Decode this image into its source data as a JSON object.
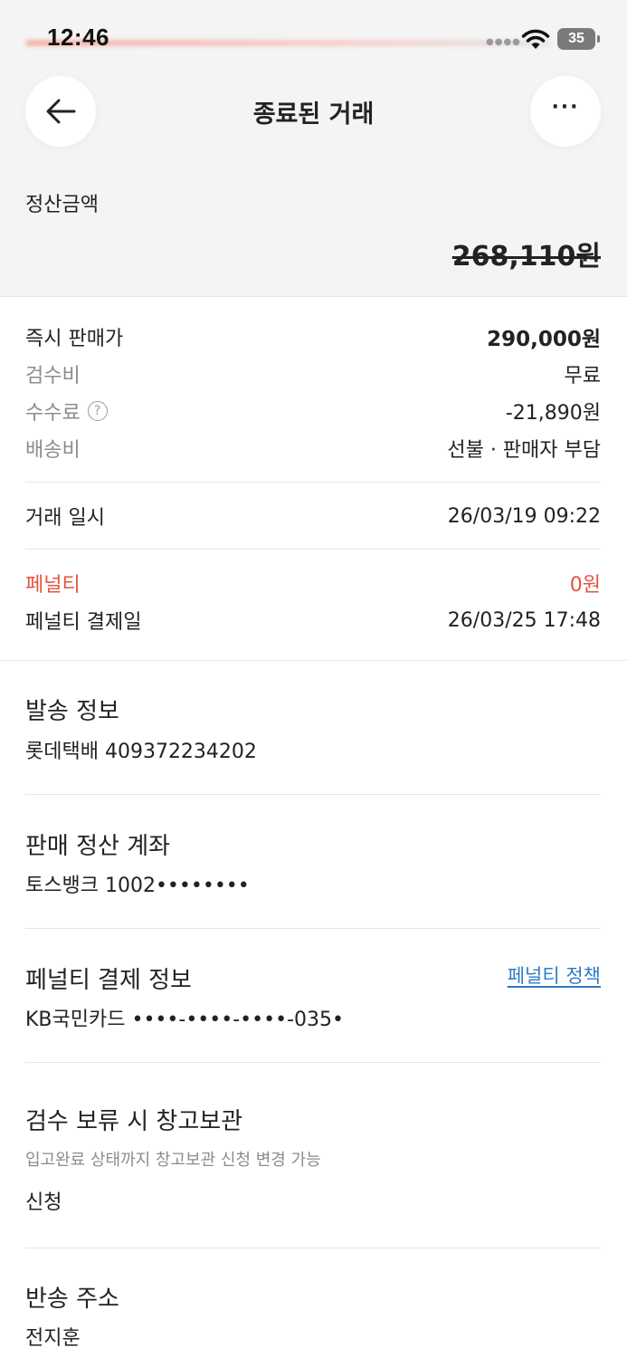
{
  "status_bar": {
    "time": "12:46",
    "battery": "35"
  },
  "header": {
    "title": "종료된 거래"
  },
  "settlement": {
    "label": "정산금액",
    "amount": "268,110원"
  },
  "price_details": {
    "instant_price_label": "즉시 판매가",
    "instant_price_value": "290,000원",
    "inspection_fee_label": "검수비",
    "inspection_fee_value": "무료",
    "commission_label": "수수료",
    "commission_value": "-21,890원",
    "shipping_label": "배송비",
    "shipping_value": "선불 · 판매자 부담"
  },
  "trade": {
    "date_label": "거래 일시",
    "date_value": "26/03/19 09:22"
  },
  "penalty": {
    "label": "페널티",
    "value": "0원",
    "pay_date_label": "페널티 결제일",
    "pay_date_value": "26/03/25 17:48"
  },
  "sections": {
    "shipping_info_title": "발송 정보",
    "shipping_info_value": "롯데택배 409372234202",
    "settlement_account_title": "판매 정산 계좌",
    "settlement_account_value": "토스뱅크 1002••••••••",
    "penalty_payment_title": "페널티 결제 정보",
    "penalty_policy_link": "페널티 정책",
    "penalty_payment_value": "KB국민카드 ••••-••••-••••-035•",
    "warehouse_title": "검수 보류 시 창고보관",
    "warehouse_note": "입고완료 상태까지 창고보관 신청 변경 가능",
    "warehouse_value": "신청",
    "return_address_title": "반송 주소",
    "return_address_name": "전지훈"
  },
  "colors": {
    "accent_red": "#e2553f",
    "link_blue": "#2f7bc4"
  }
}
